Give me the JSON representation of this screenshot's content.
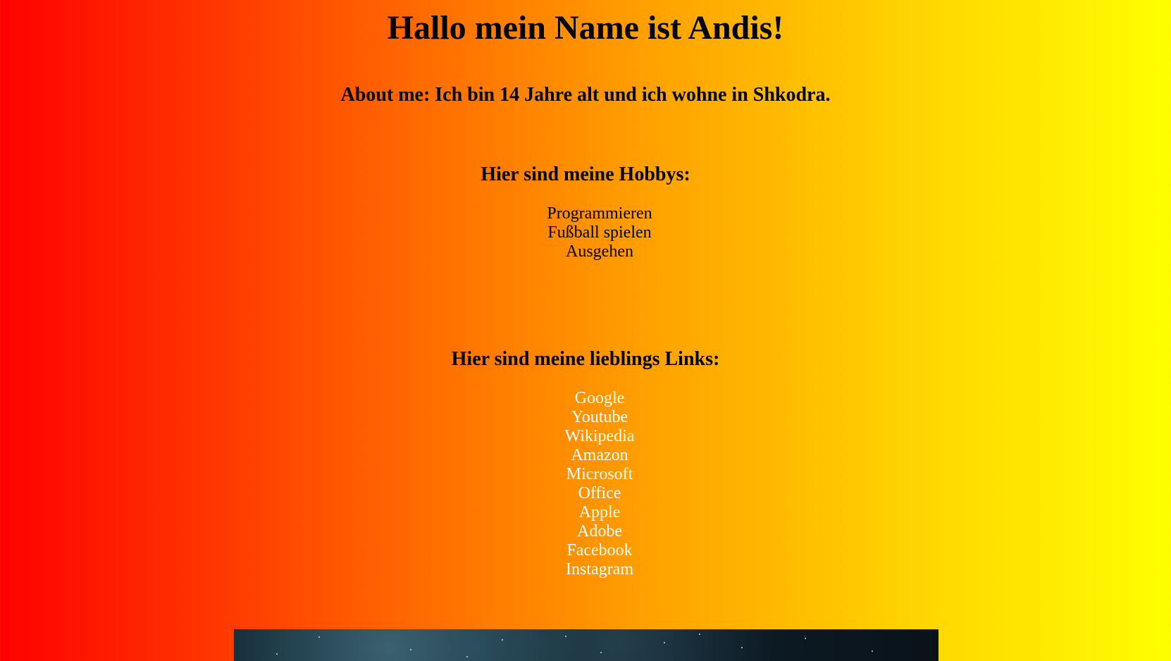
{
  "header": {
    "title": "Hallo mein Name ist Andis!"
  },
  "about": {
    "text": "About me: Ich bin 14 Jahre alt und ich wohne in Shkodra."
  },
  "hobbies": {
    "heading": "Hier sind meine Hobbys:",
    "items": [
      "Programmieren",
      "Fußball spielen",
      "Ausgehen"
    ]
  },
  "links": {
    "heading": "Hier sind meine lieblings Links:",
    "items": [
      "Google",
      "Youtube",
      "Wikipedia",
      "Amazon",
      "Microsoft",
      "Office",
      "Apple",
      "Adobe",
      "Facebook",
      "Instagram"
    ]
  },
  "colors": {
    "gradient_start": "#ff0000",
    "gradient_end": "#ffff00",
    "link_color": "#ffffff",
    "banner_dark": "#0f2430"
  }
}
